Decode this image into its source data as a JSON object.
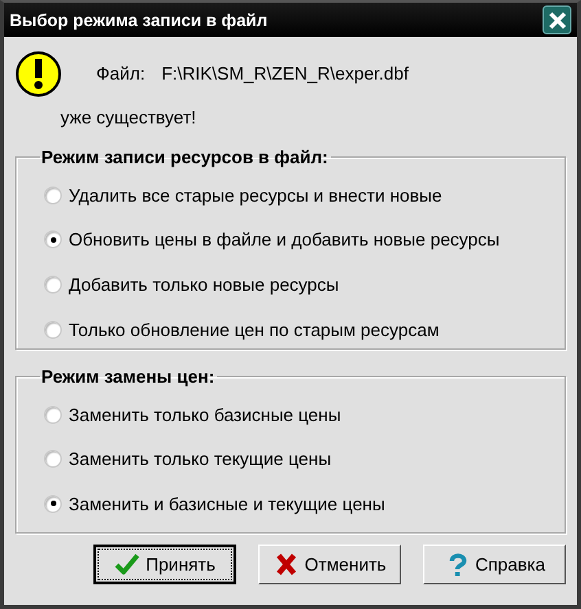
{
  "window": {
    "title": "Выбор режима записи в файл"
  },
  "message": {
    "file_label": "Файл:",
    "file_path": "F:\\RIK\\SM_R\\ZEN_R\\exper.dbf",
    "suffix": "уже существует!"
  },
  "groups": [
    {
      "title": "Режим записи ресурсов в файл:",
      "options": [
        {
          "label": "Удалить все старые ресурсы и внести новые",
          "selected": false
        },
        {
          "label": "Обновить цены в файле и добавить новые ресурсы",
          "selected": true
        },
        {
          "label": "Добавить только новые ресурсы",
          "selected": false
        },
        {
          "label": "Только обновление цен по старым ресурсам",
          "selected": false
        }
      ]
    },
    {
      "title": "Режим замены цен:",
      "options": [
        {
          "label": "Заменить только базисные цены",
          "selected": false
        },
        {
          "label": "Заменить только текущие цены",
          "selected": false
        },
        {
          "label": "Заменить и базисные и текущие цены",
          "selected": true
        }
      ]
    }
  ],
  "buttons": [
    {
      "label": "Принять",
      "kind": "accept",
      "focused": true
    },
    {
      "label": "Отменить",
      "kind": "cancel",
      "focused": false
    },
    {
      "label": "Справка",
      "kind": "help",
      "focused": false
    }
  ]
}
